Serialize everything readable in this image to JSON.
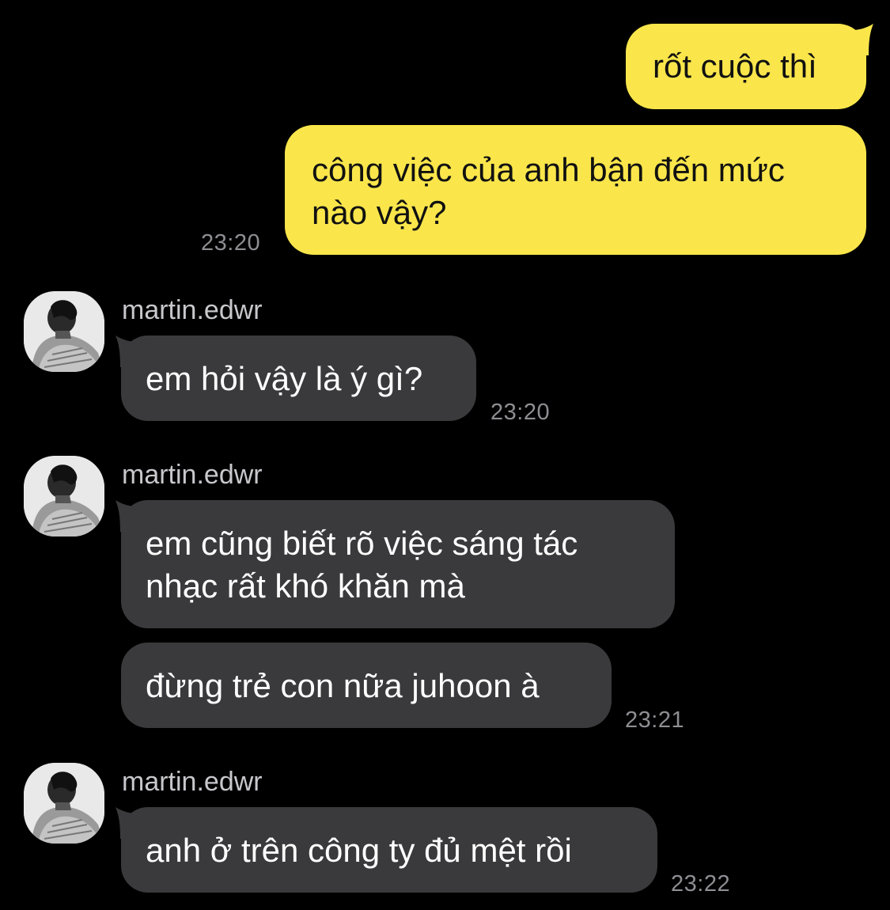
{
  "outgoing": {
    "messages": [
      {
        "lines": [
          "rốt cuộc thì"
        ]
      },
      {
        "lines": [
          "công việc của anh bận đến mức",
          "nào vậy?"
        ]
      }
    ],
    "time": "23:20"
  },
  "incoming_groups": [
    {
      "sender": "martin.edwr",
      "messages": [
        {
          "lines": [
            "em hỏi vậy là ý gì?"
          ]
        }
      ],
      "time": "23:20"
    },
    {
      "sender": "martin.edwr",
      "messages": [
        {
          "lines": [
            "em cũng biết rõ việc sáng tác",
            "nhạc rất khó khăn mà"
          ]
        },
        {
          "lines": [
            "đừng trẻ con nữa juhoon à"
          ]
        }
      ],
      "time": "23:21"
    },
    {
      "sender": "martin.edwr",
      "messages": [
        {
          "lines": [
            "anh ở trên công ty đủ mệt rồi"
          ]
        }
      ],
      "time": "23:22"
    }
  ],
  "colors": {
    "background": "#000000",
    "outgoing_bubble": "#FAE64B",
    "incoming_bubble": "#3A3A3C",
    "timestamp": "#8E8E93"
  },
  "icons": {
    "avatar": "profile-photo-avatar"
  }
}
